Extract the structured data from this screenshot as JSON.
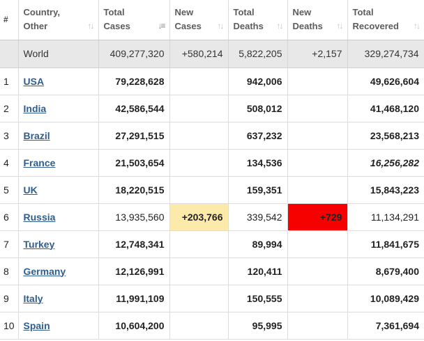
{
  "headers": {
    "num": "#",
    "country_line1": "Country,",
    "country_line2": "Other",
    "total_cases_line1": "Total",
    "total_cases_line2": "Cases",
    "new_cases_line1": "New",
    "new_cases_line2": "Cases",
    "total_deaths_line1": "Total",
    "total_deaths_line2": "Deaths",
    "new_deaths_line1": "New",
    "new_deaths_line2": "Deaths",
    "total_recovered_line1": "Total",
    "total_recovered_line2": "Recovered"
  },
  "icons": {
    "sort": "sort-arrows-icon",
    "sort_active": "sort-desc-icon"
  },
  "world": {
    "name": "World",
    "total_cases": "409,277,320",
    "new_cases": "+580,214",
    "total_deaths": "5,822,205",
    "new_deaths": "+2,157",
    "total_recovered": "329,274,734"
  },
  "rows": [
    {
      "num": "1",
      "country": "USA",
      "total_cases": "79,228,628",
      "new_cases": "",
      "total_deaths": "942,006",
      "new_deaths": "",
      "total_recovered": "49,626,604"
    },
    {
      "num": "2",
      "country": "India",
      "total_cases": "42,586,544",
      "new_cases": "",
      "total_deaths": "508,012",
      "new_deaths": "",
      "total_recovered": "41,468,120"
    },
    {
      "num": "3",
      "country": "Brazil",
      "total_cases": "27,291,515",
      "new_cases": "",
      "total_deaths": "637,232",
      "new_deaths": "",
      "total_recovered": "23,568,213"
    },
    {
      "num": "4",
      "country": "France",
      "total_cases": "21,503,654",
      "new_cases": "",
      "total_deaths": "134,536",
      "new_deaths": "",
      "total_recovered": "16,256,282"
    },
    {
      "num": "5",
      "country": "UK",
      "total_cases": "18,220,515",
      "new_cases": "",
      "total_deaths": "159,351",
      "new_deaths": "",
      "total_recovered": "15,843,223"
    },
    {
      "num": "6",
      "country": "Russia",
      "total_cases": "13,935,560",
      "new_cases": "+203,766",
      "total_deaths": "339,542",
      "new_deaths": "+729",
      "total_recovered": "11,134,291"
    },
    {
      "num": "7",
      "country": "Turkey",
      "total_cases": "12,748,341",
      "new_cases": "",
      "total_deaths": "89,994",
      "new_deaths": "",
      "total_recovered": "11,841,675"
    },
    {
      "num": "8",
      "country": "Germany",
      "total_cases": "12,126,991",
      "new_cases": "",
      "total_deaths": "120,411",
      "new_deaths": "",
      "total_recovered": "8,679,400"
    },
    {
      "num": "9",
      "country": "Italy",
      "total_cases": "11,991,109",
      "new_cases": "",
      "total_deaths": "150,555",
      "new_deaths": "",
      "total_recovered": "10,089,429"
    },
    {
      "num": "10",
      "country": "Spain",
      "total_cases": "10,604,200",
      "new_cases": "",
      "total_deaths": "95,995",
      "new_deaths": "",
      "total_recovered": "7,361,694"
    }
  ],
  "colors": {
    "new_cases_highlight": "#fbeaaa",
    "new_deaths_highlight": "#f60000",
    "link": "#2f5e8e",
    "world_row_bg": "#e8e8e8"
  }
}
